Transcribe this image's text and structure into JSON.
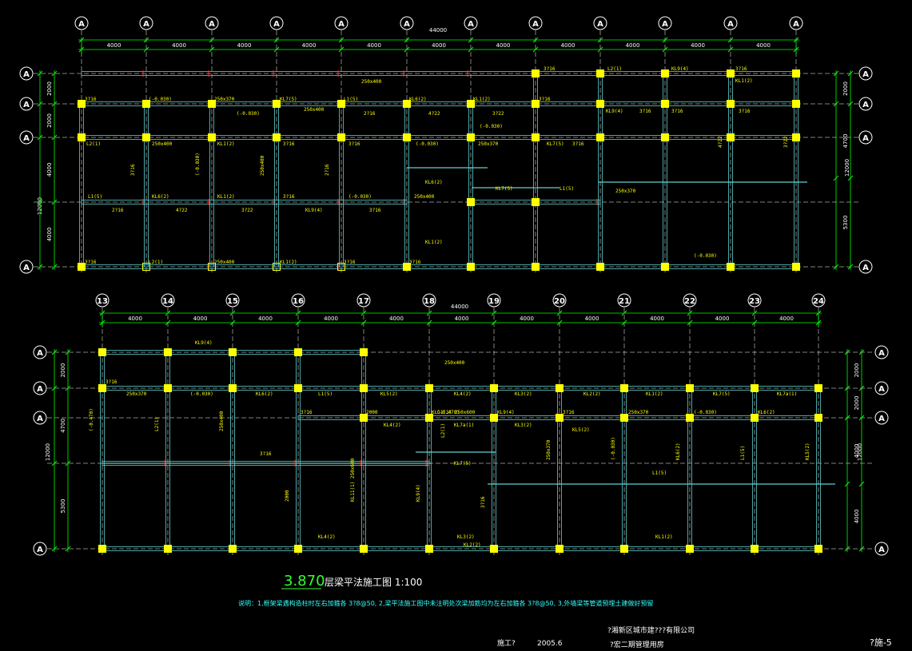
{
  "colors": {
    "background": "#000000",
    "grid": "#ffffff",
    "dimension": "#00ff00",
    "beam": "#5fd0d0",
    "column": "#ffff00",
    "text": "#ffff00",
    "note": "#33ffff",
    "marker": "#ff3030"
  },
  "top_plan": {
    "total_dim": "44000",
    "span_dims": [
      "4000",
      "4000",
      "4000",
      "4000",
      "4000",
      "4000",
      "4000",
      "4000",
      "4000",
      "4000",
      "4000"
    ],
    "col_labels": [
      "A",
      "A",
      "A",
      "A",
      "A",
      "A",
      "A",
      "A",
      "A",
      "A",
      "A",
      "A"
    ],
    "row_labels": [
      "A",
      "A",
      "A",
      "A"
    ],
    "left_dims": [
      "2000",
      "2000",
      "4000",
      "4000"
    ],
    "left_total": "12000",
    "right_dims": [
      "2000",
      "4700",
      "5300"
    ],
    "right_total": "12000",
    "labels": [
      "3?16",
      "(-0.030)",
      "250x370",
      "KL7(5)",
      "L1(5)",
      "KL6(2)",
      "KL1(2)",
      "3?16",
      "(-0.030)",
      "250x400",
      "2?16",
      "4?22",
      "3?22",
      "KL9(4)",
      "3?16",
      "3?16",
      "L2(1)",
      "250x400",
      "KL1(2)",
      "3?16"
    ]
  },
  "bottom_plan": {
    "total_dim": "44000",
    "span_dims": [
      "4000",
      "4000",
      "4000",
      "4000",
      "4000",
      "4000",
      "4000",
      "4000",
      "4000",
      "4000",
      "4000"
    ],
    "col_labels": [
      "13",
      "14",
      "15",
      "16",
      "17",
      "18",
      "19",
      "20",
      "21",
      "22",
      "23",
      "24"
    ],
    "row_labels": [
      "A",
      "A",
      "A",
      "A"
    ],
    "left_dims": [
      "2000",
      "4700",
      "5300"
    ],
    "left_total": "12000",
    "right_dims": [
      "2000",
      "2000",
      "4000",
      "4000"
    ],
    "right_total": "12000",
    "labels": [
      "KL9(4)",
      "3?16",
      "250x370",
      "(-0.030)",
      "KL6(2)",
      "L1(5)",
      "KL5(2)",
      "KL4(2)",
      "KL3(2)",
      "KL2(2)",
      "KL1(2)",
      "KL7(5)",
      "KL7a(1)",
      "(-0.470)",
      "L2(1)",
      "250x400",
      "3?16",
      "2000",
      "KL11(1) 250x600"
    ]
  },
  "title": {
    "main": "3.870",
    "suffix": "层梁平法施工图  1:100"
  },
  "note": "说明：1,框架梁遇构造柱时左右加箍各 3?8@50, 2,梁平法施工图中未注明处次梁加筋均为左右加箍各 3?8@50, 3,外墙梁等管道预埋土建做好预留",
  "title_block": {
    "company": "?湘新区城市建???有限公司",
    "project": "?宏二期管理用房",
    "stage": "施工?",
    "date": "2005.6",
    "drawing_no": "?施-5"
  }
}
